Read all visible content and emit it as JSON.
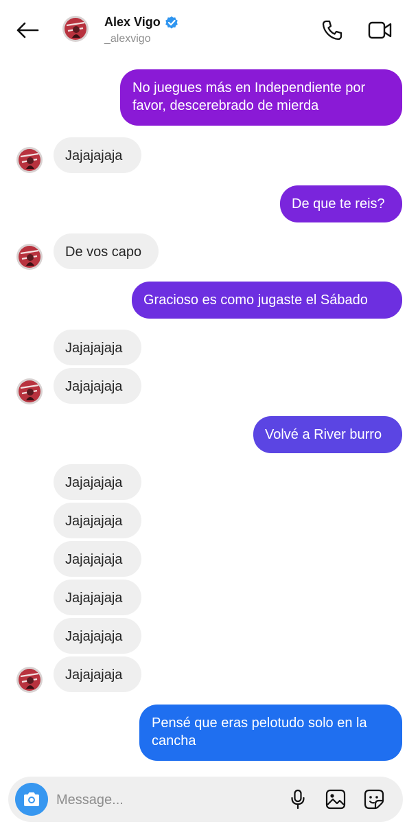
{
  "header": {
    "name": "Alex Vigo",
    "username": "_alexvigo",
    "back_icon": "arrow-left-icon",
    "call_icon": "phone-icon",
    "video_icon": "video-camera-icon",
    "verified_icon": "verified-badge-icon"
  },
  "colors": {
    "purple": "#8a1ad6",
    "violet": "#6d2fe0",
    "indigo": "#5b45e3",
    "blue": "#1f6ff0",
    "received": "#efefef",
    "camera": "#3797f0"
  },
  "messages": [
    {
      "side": "sent",
      "lines": [
        "No juegues más en Independiente por",
        "favor, descerebrado de mierda"
      ]
    },
    {
      "side": "received",
      "text": "Jajajajaja"
    },
    {
      "side": "sent",
      "lines": [
        "De que te reis?"
      ]
    },
    {
      "side": "received",
      "text": "De vos capo"
    },
    {
      "side": "sent",
      "lines": [
        "Gracioso es como jugaste el Sábado"
      ]
    },
    {
      "side": "received",
      "text": "Jajajajaja"
    },
    {
      "side": "received",
      "text": "Jajajajaja"
    },
    {
      "side": "sent",
      "lines": [
        "Volvé a River burro"
      ]
    },
    {
      "side": "received",
      "text": "Jajajajaja"
    },
    {
      "side": "received",
      "text": "Jajajajaja"
    },
    {
      "side": "received",
      "text": "Jajajajaja"
    },
    {
      "side": "received",
      "text": "Jajajajaja"
    },
    {
      "side": "received",
      "text": "Jajajajaja"
    },
    {
      "side": "received",
      "text": "Jajajajaja"
    },
    {
      "side": "sent",
      "lines": [
        "Pensé que eras pelotudo solo en la",
        "cancha"
      ]
    }
  ],
  "composer": {
    "placeholder": "Message...",
    "camera_icon": "camera-icon",
    "mic_icon": "microphone-icon",
    "gallery_icon": "image-gallery-icon",
    "sticker_icon": "sticker-icon"
  }
}
